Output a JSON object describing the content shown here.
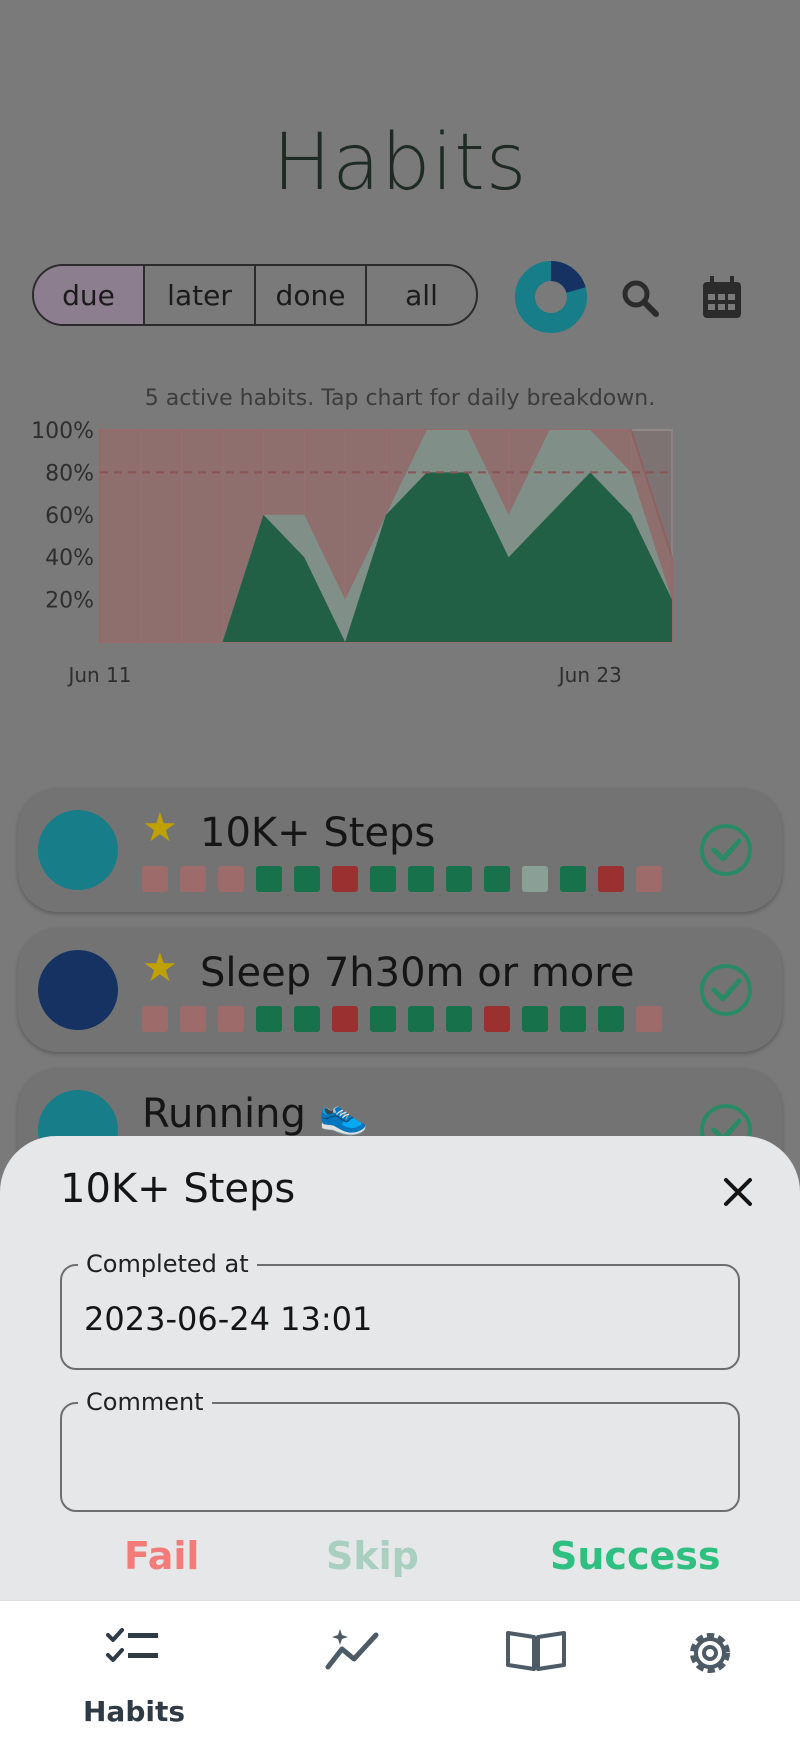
{
  "header": {
    "title": "Habits"
  },
  "filters": {
    "tabs": [
      {
        "label": "due",
        "active": true
      },
      {
        "label": "later",
        "active": false
      },
      {
        "label": "done",
        "active": false
      },
      {
        "label": "all",
        "active": false
      }
    ]
  },
  "chart_caption": "5 active habits. Tap chart for daily breakdown.",
  "chart_data": {
    "type": "area",
    "x": [
      "Jun 11",
      "Jun 12",
      "Jun 13",
      "Jun 14",
      "Jun 15",
      "Jun 16",
      "Jun 17",
      "Jun 18",
      "Jun 19",
      "Jun 20",
      "Jun 21",
      "Jun 22",
      "Jun 23",
      "Jun 24",
      "Jun 25"
    ],
    "x_tick_labels": [
      "Jun 11",
      "Jun 23"
    ],
    "y_tick_labels": [
      "100%",
      "80%",
      "60%",
      "40%",
      "20%"
    ],
    "ylim": [
      0,
      100
    ],
    "target_line": 80,
    "series": [
      {
        "values": [
          0,
          0,
          0,
          0,
          60,
          40,
          0,
          60,
          80,
          80,
          40,
          60,
          80,
          60,
          20
        ]
      },
      {
        "values": [
          0,
          0,
          0,
          0,
          60,
          60,
          20,
          60,
          100,
          100,
          60,
          100,
          100,
          80,
          20
        ]
      },
      {
        "values": [
          100,
          100,
          100,
          100,
          100,
          100,
          100,
          100,
          100,
          100,
          100,
          100,
          100,
          100,
          40
        ]
      }
    ],
    "colors": {
      "success": "#226046",
      "skip": "#808f87",
      "fail": "#9e6b6b",
      "target": "#8a5555"
    }
  },
  "habits": [
    {
      "name": "10K+ Steps",
      "starred": true,
      "avatar_color": "#177e89",
      "history": [
        "fail",
        "fail",
        "fail",
        "success",
        "success",
        "failed",
        "success",
        "success",
        "success",
        "success",
        "skip",
        "success",
        "failed",
        "fail"
      ]
    },
    {
      "name": "Sleep 7h30m or more",
      "starred": true,
      "avatar_color": "#153263",
      "history": [
        "fail",
        "fail",
        "fail",
        "success",
        "success",
        "failed",
        "success",
        "success",
        "success",
        "failed",
        "success",
        "success",
        "success",
        "fail"
      ]
    },
    {
      "name": "Running 👟",
      "starred": false,
      "avatar_color": "#177e89",
      "history": []
    }
  ],
  "habit_colors": {
    "fail": "#9e6b6b",
    "failed": "#9a3030",
    "success": "#17714a",
    "skip": "#8a9f96"
  },
  "sheet": {
    "title": "10K+ Steps",
    "completed_label": "Completed at",
    "completed_value": "2023-06-24 13:01",
    "comment_label": "Comment",
    "comment_value": "",
    "fail_label": "Fail",
    "skip_label": "Skip",
    "success_label": "Success",
    "colors": {
      "fail": "#f37b79",
      "skip": "#a8cfbf",
      "success": "#2fbf81"
    }
  },
  "nav": {
    "items": [
      {
        "label": "Habits",
        "icon": "checklist-icon",
        "active": true
      },
      {
        "label": "",
        "icon": "trending-icon",
        "active": false
      },
      {
        "label": "",
        "icon": "book-icon",
        "active": false
      },
      {
        "label": "",
        "icon": "gear-icon",
        "active": false
      }
    ]
  }
}
